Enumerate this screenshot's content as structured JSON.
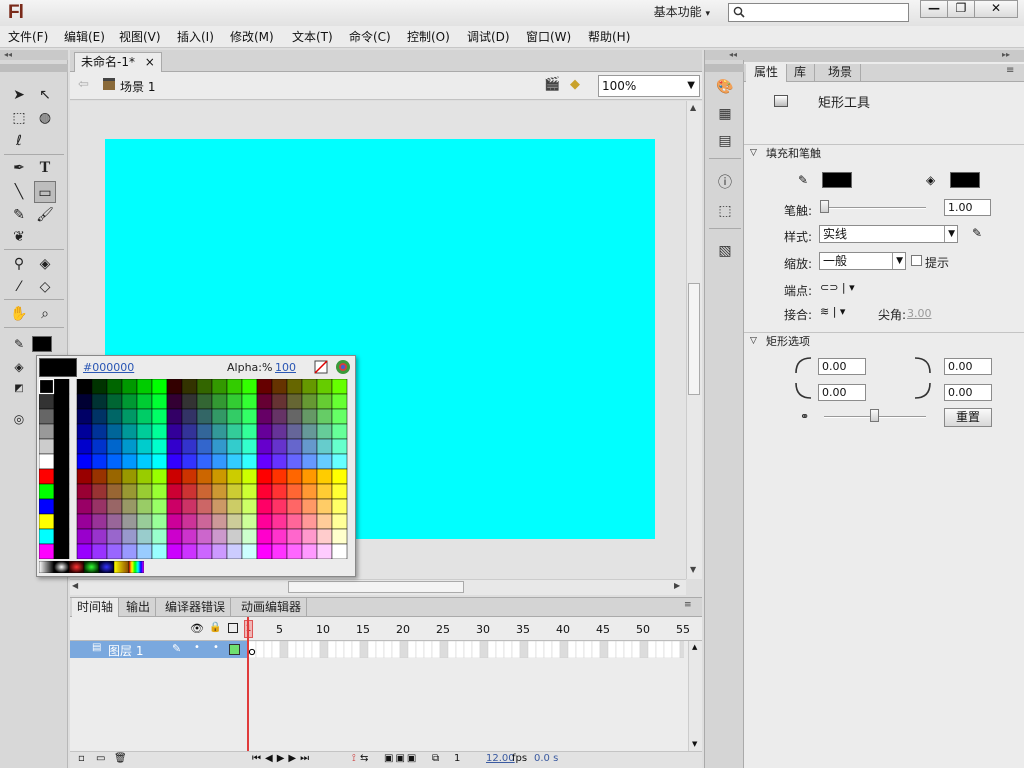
{
  "app": {
    "logo": "Fl",
    "workspace": "基本功能",
    "search_placeholder": ""
  },
  "window_controls": [
    "—",
    "❐",
    "✕"
  ],
  "menu": [
    "文件(F)",
    "编辑(E)",
    "视图(V)",
    "插入(I)",
    "修改(M)",
    "文本(T)",
    "命令(C)",
    "控制(O)",
    "调试(D)",
    "窗口(W)",
    "帮助(H)"
  ],
  "document": {
    "tab_title": "未命名-1*",
    "tab_close": "×",
    "scene": "场景 1",
    "zoom": "100%",
    "stage_color": "#00ffff"
  },
  "tools": [
    "selection-tool",
    "subselection-tool",
    "free-transform-tool",
    "3d-rotation-tool",
    "lasso-tool",
    "pen-tool",
    "text-tool",
    "line-tool",
    "rectangle-tool",
    "pencil-tool",
    "brush-tool",
    "deco-tool",
    "bone-tool",
    "paint-bucket-tool",
    "eyedropper-tool",
    "eraser-tool",
    "hand-tool",
    "zoom-tool",
    "stroke-color",
    "fill-color"
  ],
  "color_popup": {
    "hex": "#000000",
    "alpha_label": "Alpha:%",
    "alpha_value": "100"
  },
  "timeline": {
    "tabs": [
      "时间轴",
      "输出",
      "编译器错误",
      "动画编辑器"
    ],
    "frame_numbers": [
      "5",
      "10",
      "15",
      "20",
      "25",
      "30",
      "35",
      "40",
      "45",
      "50",
      "55"
    ],
    "current_frame_marker": "1",
    "layer_name": "图层 1",
    "frame": "1",
    "fps": "12.00",
    "fps_unit": "fps",
    "time": "0.0 s"
  },
  "properties": {
    "tabs": [
      "属性",
      "库",
      "场景"
    ],
    "tool_name": "矩形工具",
    "fill_stroke_section": "填充和笔触",
    "stroke_label": "笔触:",
    "stroke_value": "1.00",
    "style_label": "样式:",
    "style_value": "实线",
    "scale_label": "缩放:",
    "scale_value": "一般",
    "hint_label": "提示",
    "cap_label": "端点:",
    "join_label": "接合:",
    "miter_label": "尖角:",
    "miter_value": "3.00",
    "rect_section": "矩形选项",
    "corner_tl": "0.00",
    "corner_tr": "0.00",
    "corner_bl": "0.00",
    "corner_br": "0.00",
    "reset_label": "重置"
  }
}
